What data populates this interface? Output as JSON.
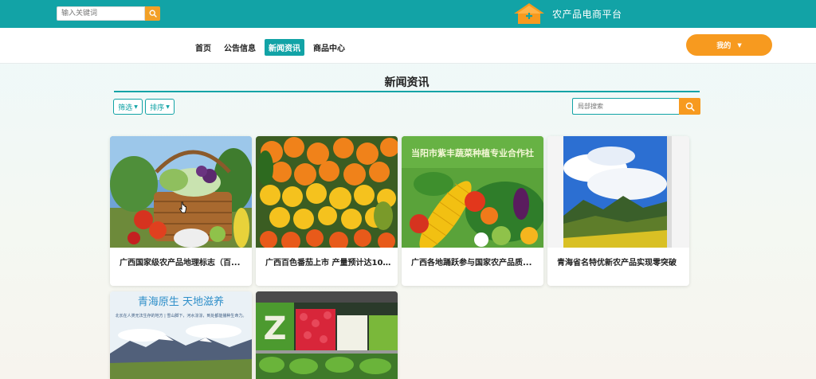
{
  "topbar": {
    "search_placeholder": "输入关键词",
    "brand_name": "农产品电商平台",
    "colors": {
      "bar": "#12a3a6",
      "accent": "#f79a1f"
    }
  },
  "nav": {
    "items": [
      {
        "label": "首页",
        "active": false
      },
      {
        "label": "公告信息",
        "active": false
      },
      {
        "label": "新闻资讯",
        "active": true
      },
      {
        "label": "商品中心",
        "active": false
      }
    ],
    "user_label": "我的"
  },
  "page": {
    "title": "新闻资讯",
    "filter_label": "筛选",
    "sort_label": "排序",
    "local_search_placeholder": "局部搜索"
  },
  "cards": [
    {
      "title": "广西国家级农产品地理标志（百...",
      "image": "vegetable-basket"
    },
    {
      "title": "广西百色番茄上市 产量预计达10...",
      "image": "oranges-and-fruit"
    },
    {
      "title": "广西各地踊跃参与国家农产品质...",
      "image": "corn-and-vegetables",
      "image_text": "当阳市紫丰蔬菜种植专业合作社"
    },
    {
      "title": "青海省名特优新农产品实现零突破",
      "image": "mountain-landscape"
    },
    {
      "title": "",
      "image": "qinghai-poster",
      "image_text": "青海原生 天地滋养",
      "image_subtext": "北长在人类无法生存的地方 | 雪山脚下，河水淙淙，到处都能播种生命力。"
    },
    {
      "title": "",
      "image": "supermarket-produce",
      "image_text": "Z"
    }
  ]
}
